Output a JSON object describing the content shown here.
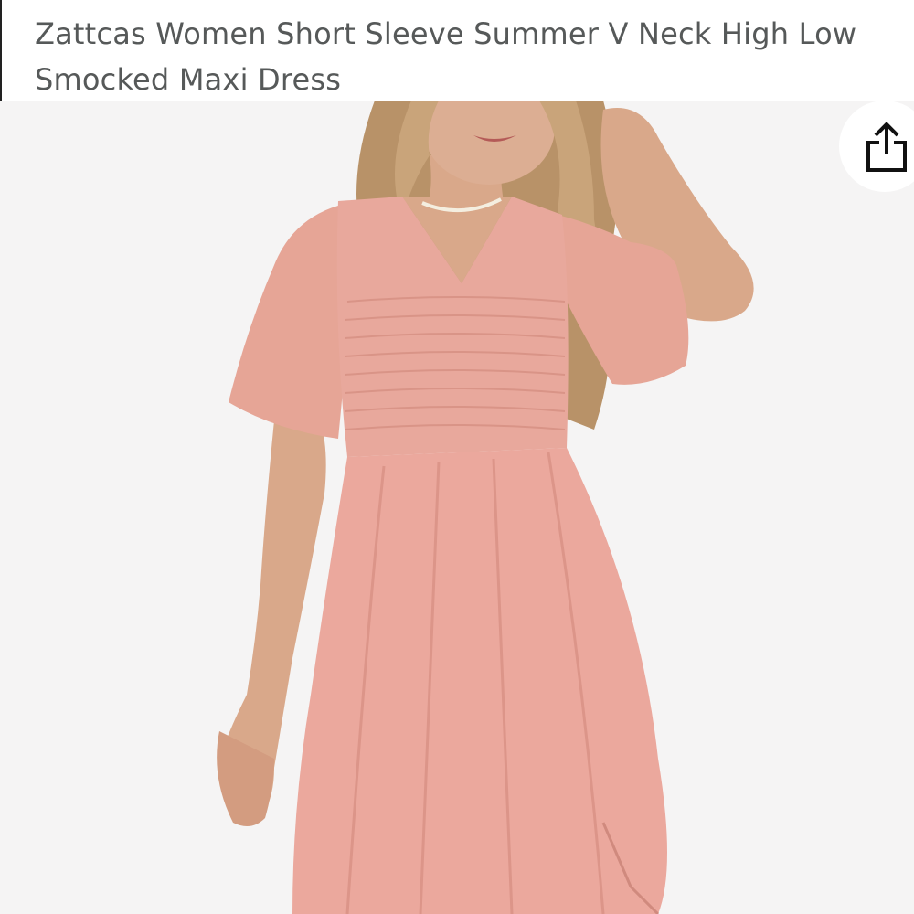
{
  "product": {
    "title": "Zattcas Women Short Sleeve Summer V Neck High Low Smocked Maxi Dress",
    "image_subject": "woman wearing pink smocked short sleeve v-neck dress",
    "dress_color": "#e8a89c",
    "background_color": "#f5f4f4"
  },
  "actions": {
    "share_icon": "share-icon"
  }
}
